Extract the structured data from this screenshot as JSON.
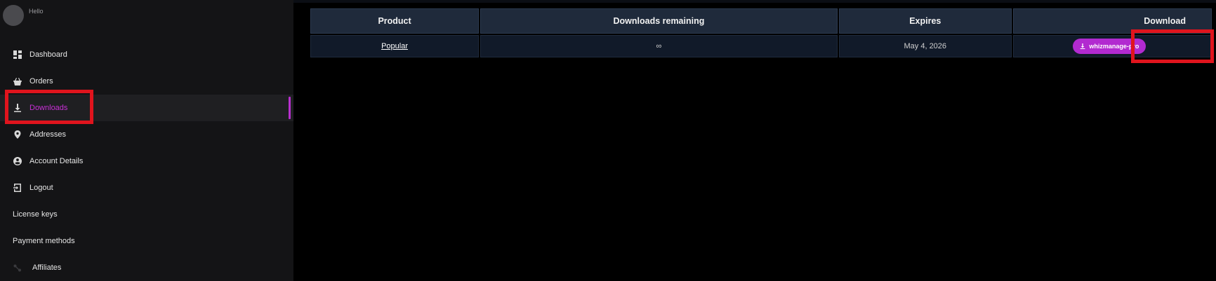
{
  "profile": {
    "greeting": "Hello"
  },
  "sidebar": {
    "items": [
      {
        "label": "Dashboard",
        "icon": "dashboard-icon"
      },
      {
        "label": "Orders",
        "icon": "basket-icon"
      },
      {
        "label": "Downloads",
        "icon": "download-icon",
        "active": true
      },
      {
        "label": "Addresses",
        "icon": "location-pin-icon"
      },
      {
        "label": "Account Details",
        "icon": "account-circle-icon"
      },
      {
        "label": "Logout",
        "icon": "logout-icon"
      },
      {
        "label": "License keys"
      },
      {
        "label": "Payment methods"
      },
      {
        "label": "Affiliates",
        "icon": "link-icon"
      }
    ]
  },
  "downloads_table": {
    "headers": [
      "Product",
      "Downloads remaining",
      "Expires",
      "Download"
    ],
    "rows": [
      {
        "product": "Popular",
        "downloads_remaining": "∞",
        "expires": "May 4, 2026",
        "download_label": "whizmanage-pro"
      }
    ]
  },
  "colors": {
    "accent": "#b22ad0",
    "active_text": "#c82fd6",
    "highlight": "#e0141d",
    "table_header": "#1f2a3b",
    "table_row": "#111a29"
  }
}
